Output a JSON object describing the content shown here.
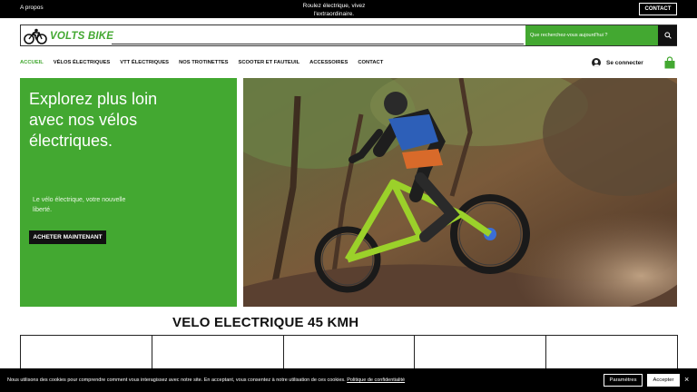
{
  "topbar": {
    "about": "A propos",
    "tagline": "Roulez électrique, vivez l'extraordinaire.",
    "contact_button": "CONTACT"
  },
  "header": {
    "logo_text": "VOLTS BIKE",
    "search_placeholder": "Que recherchez-vous aujourd'hui ?"
  },
  "nav": {
    "items": [
      {
        "label": "ACCUEIL",
        "active": true
      },
      {
        "label": "VÉLOS ÉLECTRIQUES"
      },
      {
        "label": "VTT ÉLECTRIQUES"
      },
      {
        "label": "NOS TROTINETTES"
      },
      {
        "label": "SCOOTER ET FAUTEUIL"
      },
      {
        "label": "ACCESSOIRES"
      },
      {
        "label": "CONTACT"
      }
    ],
    "login_label": "Se connecter"
  },
  "hero": {
    "headline": "Explorez plus loin avec nos vélos électriques.",
    "subtext": "Le vélo électrique, votre nouvelle liberté.",
    "cta": "ACHETER MAINTENANT"
  },
  "section": {
    "title": "VELO ELECTRIQUE 45 KMH"
  },
  "cookie": {
    "text": "Nous utilisons des cookies pour comprendre comment vous interagissez avec notre site. En acceptant, vous consentez à notre utilisation de ces cookies.",
    "policy_link": "Politique de confidentialité",
    "settings_button": "Paramètres",
    "accept_button": "Accepter",
    "close": "×"
  },
  "colors": {
    "brand_green": "#43a831",
    "black": "#000000"
  },
  "icons": [
    "bicycle-logo-icon",
    "search-icon",
    "user-avatar-icon",
    "shopping-bag-icon",
    "close-icon"
  ]
}
